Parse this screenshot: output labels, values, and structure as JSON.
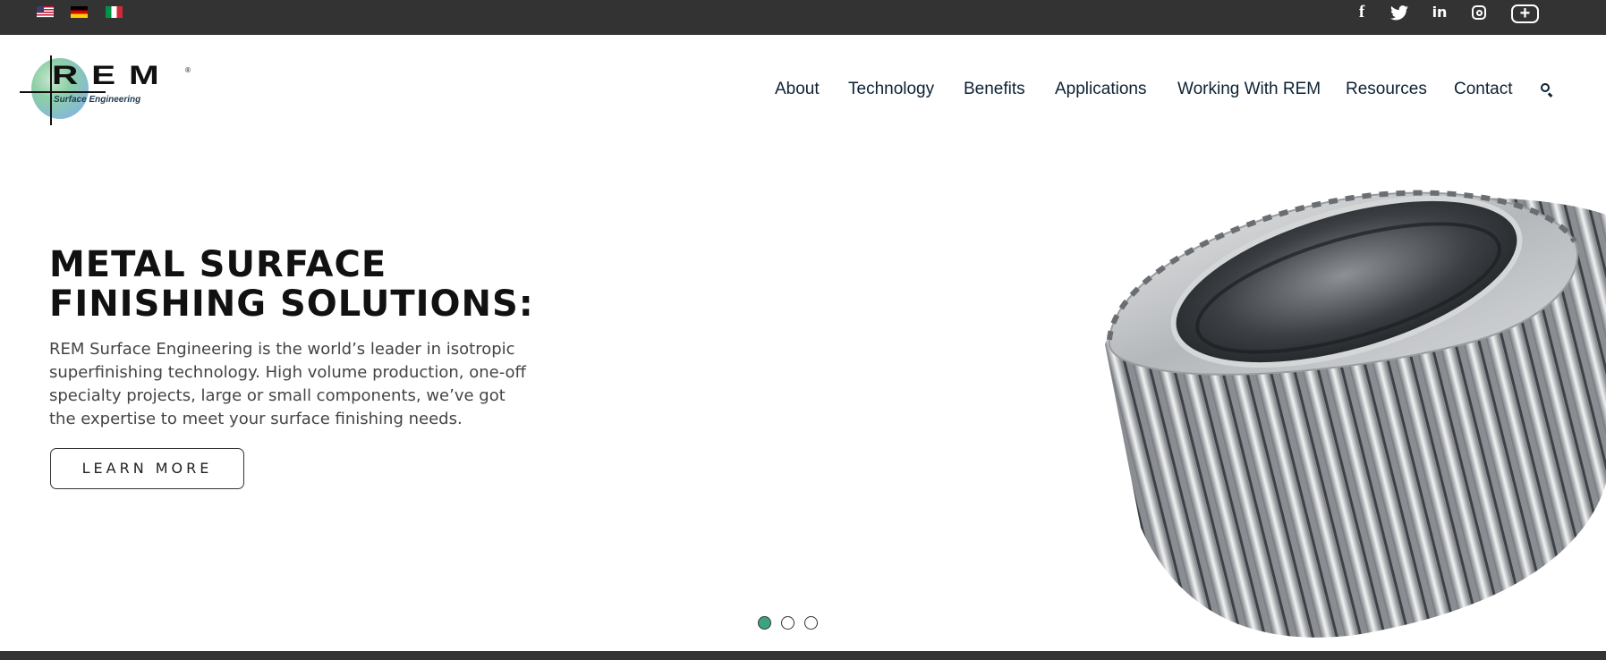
{
  "topbar": {
    "flags": [
      "us-flag-icon",
      "germany-flag-icon",
      "italy-flag-icon"
    ],
    "social": {
      "facebook_glyph": "f",
      "twitter_glyph": "🐦",
      "linkedin_glyph": "in",
      "plus_glyph": "+"
    },
    "background": "#333333"
  },
  "logo": {
    "wordmark": "REM",
    "registered": "®",
    "tagline": "Surface Engineering"
  },
  "nav": {
    "items": [
      "About",
      "Technology",
      "Benefits",
      "Applications",
      "Working With REM",
      "Resources",
      "Contact"
    ],
    "color": "#0d2233",
    "search_icon": "search-icon"
  },
  "hero": {
    "headline_line1": "METAL SURFACE",
    "headline_line2": "FINISHING SOLUTIONS:",
    "description": "REM Surface Engineering is the world’s leader in isotropic superfinishing technology. High volume production, one-off specialty projects, large or small components, we’ve got the expertise to meet your surface finishing needs.",
    "cta_label": "LEARN MORE",
    "image": "gear-image"
  },
  "carousel": {
    "slide_count": 3,
    "active_index": 0,
    "active_color": "#3aa57e"
  }
}
